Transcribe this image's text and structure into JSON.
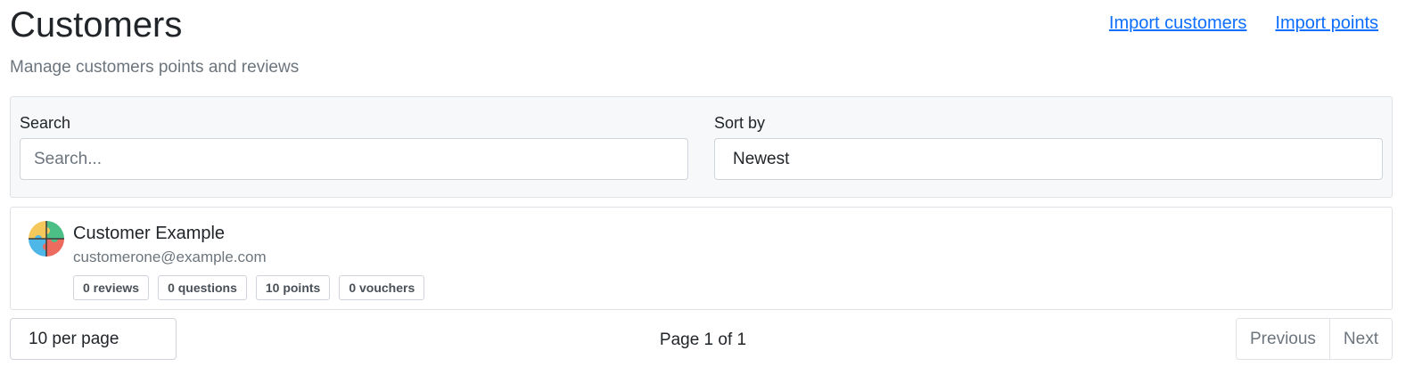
{
  "header": {
    "title": "Customers",
    "subtitle": "Manage customers points and reviews",
    "links": [
      "Import customers",
      "Import points"
    ]
  },
  "filters": {
    "search_label": "Search",
    "search_placeholder": "Search...",
    "sort_label": "Sort by",
    "sort_value": "Newest"
  },
  "customers": [
    {
      "name": "Customer Example",
      "email": "customerone@example.com",
      "avatar_icon": "puzzle-icon",
      "badges": [
        "0 reviews",
        "0 questions",
        "10 points",
        "0 vouchers"
      ]
    }
  ],
  "pagination": {
    "per_page": "10 per page",
    "page_text": "Page 1 of 1",
    "previous": "Previous",
    "next": "Next"
  },
  "colors": {
    "link": "#0d6efd",
    "muted": "#6c757d",
    "panel_bg": "#f7f8fa"
  }
}
